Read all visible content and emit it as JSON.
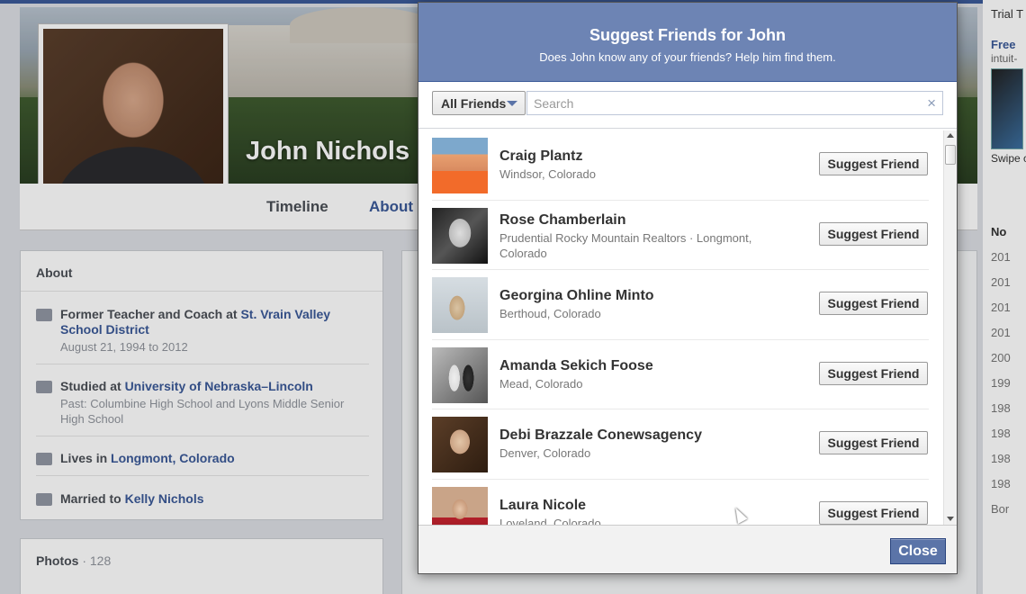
{
  "profile": {
    "name": "John Nichols",
    "tabs": [
      "Timeline",
      "About"
    ],
    "about": {
      "title": "About",
      "work_prefix": "Former Teacher and Coach at ",
      "work_place": "St. Vrain Valley School District",
      "work_dates": "August 21, 1994 to 2012",
      "study_prefix": "Studied at ",
      "study_place": "University of Nebraska–Lincoln",
      "study_past": "Past: Columbine High School and Lyons Middle Senior High School",
      "lives_prefix": "Lives in ",
      "lives_place": "Longmont, Colorado",
      "married_prefix": "Married to ",
      "married_name": "Kelly Nichols"
    },
    "photos": {
      "label": "Photos",
      "count": "· 128"
    }
  },
  "right_column": {
    "ad_text": "Swipe cell. G Free!",
    "ad_title": "Free",
    "ad_source": "intuit-",
    "ad_top": "Trial T",
    "years_header": "No",
    "years": [
      "201",
      "201",
      "201",
      "201",
      "200",
      "199",
      "198",
      "198",
      "198",
      "198",
      "Bor"
    ]
  },
  "modal": {
    "title": "Suggest Friends for John",
    "subtitle": "Does John know any of your friends? Help him find them.",
    "filter_label": "All Friends",
    "search_placeholder": "Search",
    "clear_icon": "×",
    "suggest_label": "Suggest Friend",
    "close_label": "Close",
    "friends": [
      {
        "name": "Craig Plantz",
        "location": "Windsor, Colorado"
      },
      {
        "name": "Rose Chamberlain",
        "location": "Prudential Rocky Mountain Realtors · Longmont, Colorado"
      },
      {
        "name": "Georgina Ohline Minto",
        "location": "Berthoud, Colorado"
      },
      {
        "name": "Amanda Sekich Foose",
        "location": "Mead, Colorado"
      },
      {
        "name": "Debi Brazzale Conewsagency",
        "location": "Denver, Colorado"
      },
      {
        "name": "Laura Nicole",
        "location": "Loveland, Colorado"
      }
    ]
  },
  "colors": {
    "facebook_blue": "#3b5998",
    "modal_header": "#6d84b4",
    "close_button": "#5b74a8"
  }
}
